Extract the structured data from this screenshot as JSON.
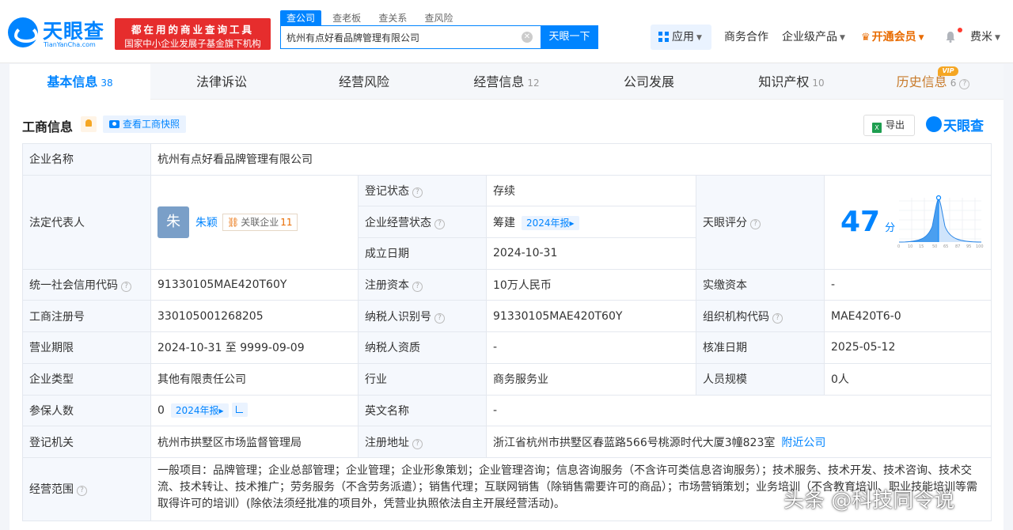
{
  "header": {
    "logo_text": "天眼查",
    "logo_sub": "TianYanCha.com",
    "banner_line1": "都在用的商业查询工具",
    "banner_line2": "国家中小企业发展子基金旗下机构",
    "search_tabs": [
      "查公司",
      "查老板",
      "查关系",
      "查风险"
    ],
    "search_value": "杭州有点好看品牌管理有限公司",
    "search_button": "天眼一下",
    "nav": {
      "apps": "应用",
      "business": "商务合作",
      "enterprise": "企业级产品",
      "vip": "开通会员",
      "user": "费米"
    }
  },
  "tabs": [
    {
      "label": "基本信息",
      "count": "38"
    },
    {
      "label": "法律诉讼",
      "count": ""
    },
    {
      "label": "经营风险",
      "count": ""
    },
    {
      "label": "经营信息",
      "count": "12"
    },
    {
      "label": "公司发展",
      "count": ""
    },
    {
      "label": "知识产权",
      "count": "10"
    },
    {
      "label": "历史信息",
      "count": "6"
    }
  ],
  "vip_badge": "VIP",
  "section": {
    "title": "工商信息",
    "snapshot_button": "查看工商快照",
    "export_button": "导出",
    "brand_mark": "天眼查"
  },
  "company": {
    "name_label": "企业名称",
    "name": "杭州有点好看品牌管理有限公司",
    "legal_label": "法定代表人",
    "legal_avatar": "朱",
    "legal_name": "朱颖",
    "related_label": "关联企业",
    "related_count": "11",
    "reg_status_label": "登记状态",
    "reg_status": "存续",
    "biz_status_label": "企业经营状态",
    "biz_status": "筹建",
    "report_year": "2024年报",
    "est_date_label": "成立日期",
    "est_date": "2024-10-31",
    "score_label": "天眼评分",
    "score": "47",
    "score_unit": "分",
    "score_axis": [
      "0",
      "10",
      "15",
      "50",
      "65",
      "87",
      "95",
      "100"
    ],
    "credit_code_label": "统一社会信用代码",
    "credit_code": "91330105MAE420T60Y",
    "reg_capital_label": "注册资本",
    "reg_capital": "10万人民币",
    "paid_capital_label": "实缴资本",
    "paid_capital": "-",
    "reg_no_label": "工商注册号",
    "reg_no": "330105001268205",
    "taxpayer_id_label": "纳税人识别号",
    "taxpayer_id": "91330105MAE420T60Y",
    "org_code_label": "组织机构代码",
    "org_code": "MAE420T6-0",
    "term_label": "营业期限",
    "term": "2024-10-31 至 9999-09-09",
    "taxpayer_qual_label": "纳税人资质",
    "taxpayer_qual": "-",
    "approve_date_label": "核准日期",
    "approve_date": "2025-05-12",
    "type_label": "企业类型",
    "type": "其他有限责任公司",
    "industry_label": "行业",
    "industry": "商务服务业",
    "staff_label": "人员规模",
    "staff": "0人",
    "insured_label": "参保人数",
    "insured": "0",
    "english_label": "英文名称",
    "english": "-",
    "authority_label": "登记机关",
    "authority": "杭州市拱墅区市场监督管理局",
    "address_label": "注册地址",
    "address": "浙江省杭州市拱墅区春蓝路566号桃源时代大厦3幢823室",
    "nearby_link": "附近公司",
    "scope_label": "经营范围",
    "scope": "一般项目：品牌管理；企业总部管理；企业管理；企业形象策划；企业管理咨询；信息咨询服务（不含许可类信息咨询服务）；技术服务、技术开发、技术咨询、技术交流、技术转让、技术推广；劳务服务（不含劳务派遣）；销售代理；互联网销售（除销售需要许可的商品）；市场营销策划；业务培训（不含教育培训、职业技能培训等需取得许可的培训）(除依法须经批准的项目外，凭营业执照依法自主开展经营活动)。"
  },
  "watermark": "头条 @科技同令说",
  "colors": {
    "brand": "#0084ff",
    "banner": "#e62d2d",
    "vip": "#e86b00",
    "status_ok": "#1aaa55"
  }
}
